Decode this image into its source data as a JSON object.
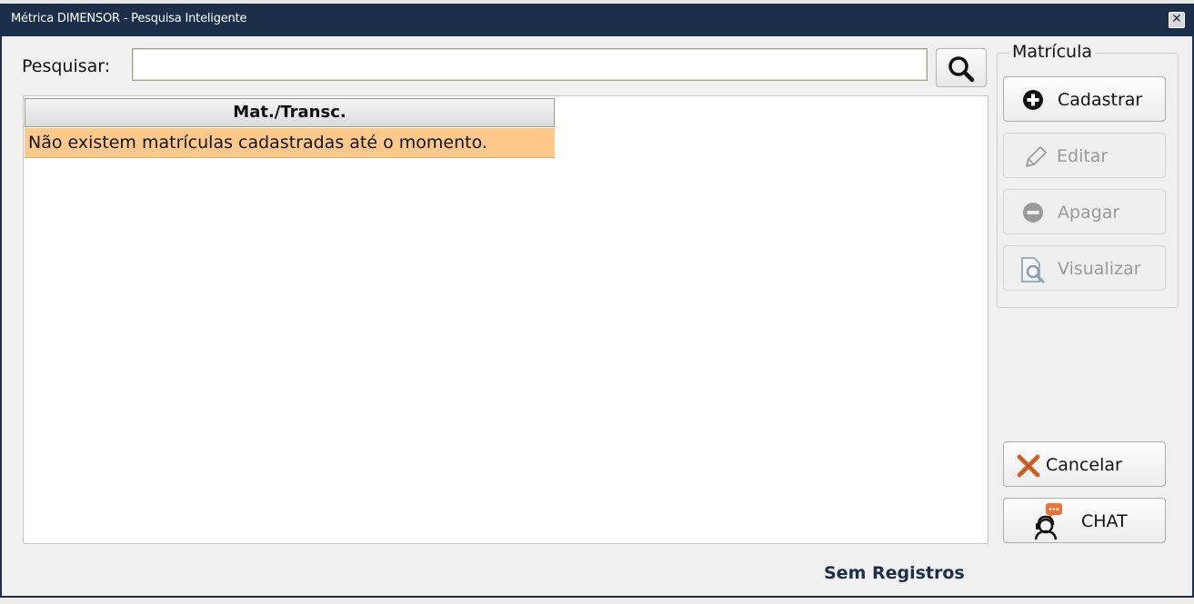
{
  "window": {
    "title": "Métrica DIMENSOR - Pesquisa Inteligente",
    "close_glyph": "✕"
  },
  "search": {
    "label": "Pesquisar:",
    "value": "",
    "placeholder": ""
  },
  "table": {
    "columns": [
      "Mat./Transc."
    ],
    "rows": [
      [
        "Não existem matrículas cadastradas até o momento."
      ]
    ]
  },
  "group": {
    "title": "Matrícula"
  },
  "actions": {
    "cadastrar": {
      "label": "Cadastrar",
      "icon": "plus-circle-icon",
      "enabled": true
    },
    "editar": {
      "label": "Editar",
      "icon": "pencil-icon",
      "enabled": false
    },
    "apagar": {
      "label": "Apagar",
      "icon": "minus-circle-icon",
      "enabled": false
    },
    "visualizar": {
      "label": "Visualizar",
      "icon": "document-search-icon",
      "enabled": false
    }
  },
  "footer_buttons": {
    "cancelar": {
      "label": "Cancelar",
      "icon": "x-icon"
    },
    "chat": {
      "label": "CHAT",
      "icon": "chat-support-icon"
    }
  },
  "status": {
    "text": "Sem Registros"
  },
  "colors": {
    "titlebar": "#1b2f4b",
    "row_highlight": "#fcc98b",
    "status_text": "#1b2f4b",
    "cancel_icon": "#e06a2a",
    "chat_icon_bubble": "#e8743c"
  }
}
